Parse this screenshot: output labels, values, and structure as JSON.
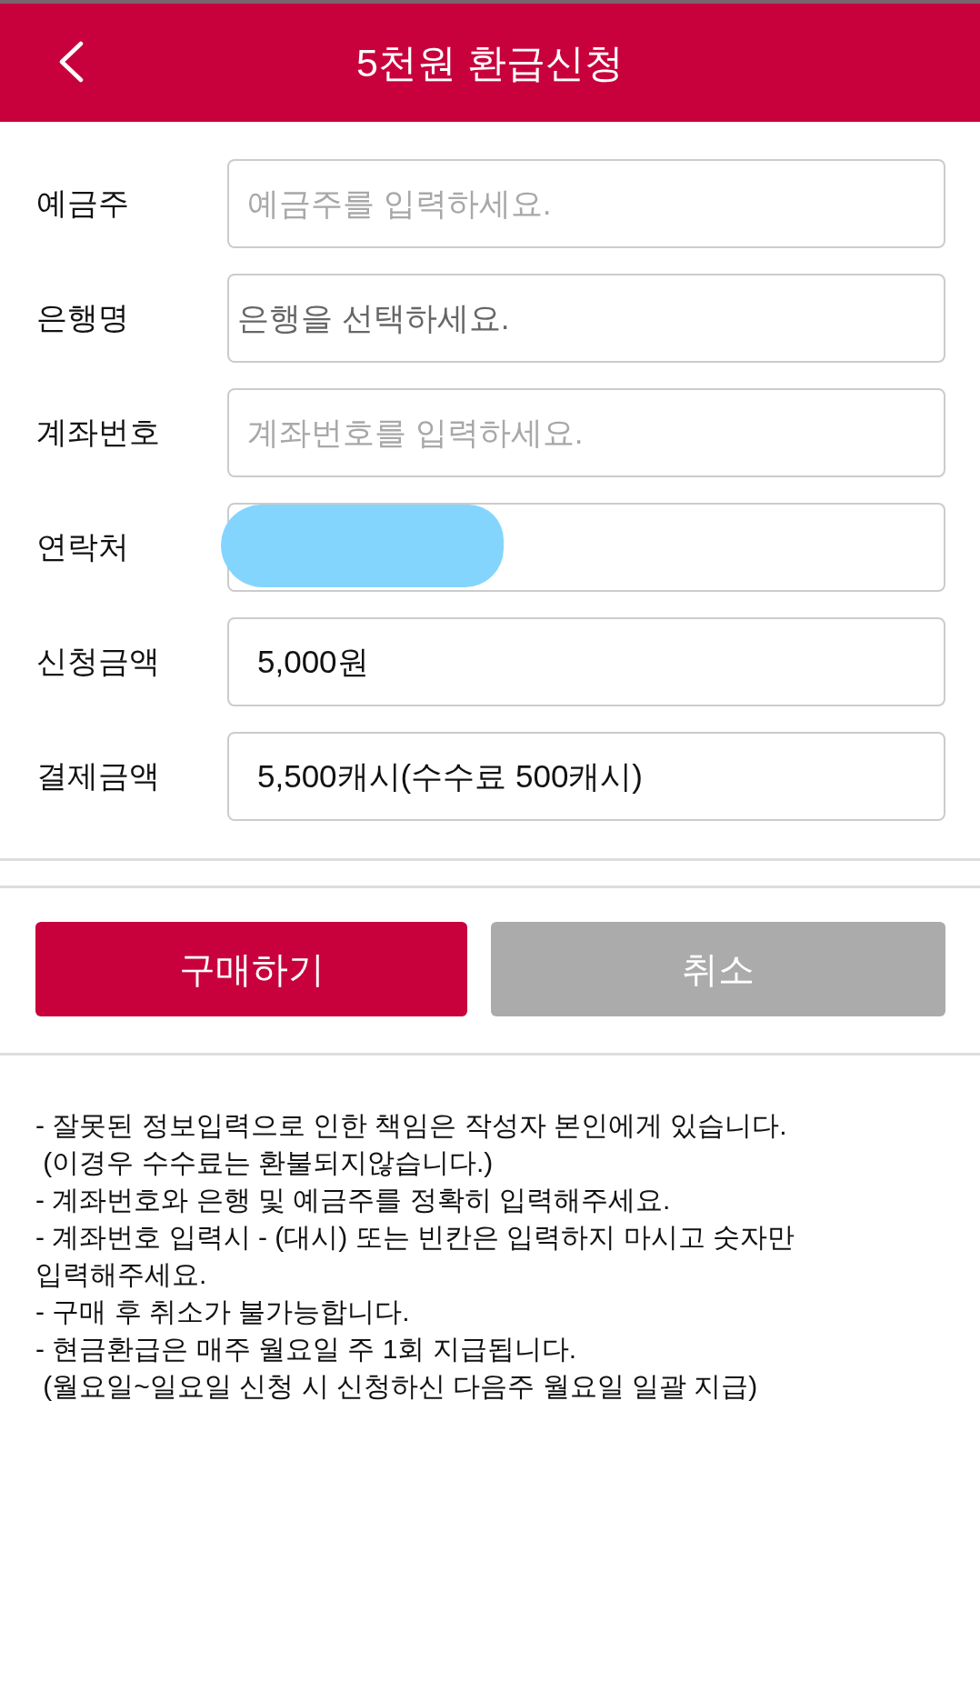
{
  "header": {
    "title": "5천원 환급신청"
  },
  "form": {
    "fields": [
      {
        "label": "예금주",
        "kind": "input",
        "placeholder": "예금주를 입력하세요."
      },
      {
        "label": "은행명",
        "kind": "select",
        "value": "은행을 선택하세요."
      },
      {
        "label": "계좌번호",
        "kind": "input",
        "placeholder": "계좌번호를 입력하세요."
      },
      {
        "label": "연락처",
        "kind": "input",
        "redacted": true
      },
      {
        "label": "신청금액",
        "kind": "input",
        "value": "5,000원"
      },
      {
        "label": "결제금액",
        "kind": "input",
        "value": "5,500캐시(수수료 500캐시)"
      }
    ]
  },
  "buttons": [
    {
      "label": "구매하기",
      "kind": "primary"
    },
    {
      "label": "취소",
      "kind": "secondary"
    }
  ],
  "notes": [
    "- 잘못된 정보입력으로 인한 책임은 작성자 본인에게 있습니다.",
    " (이경우 수수료는 환불되지않습니다.)",
    "- 계좌번호와 은행 및 예금주를 정확히 입력해주세요.",
    "- 계좌번호 입력시 - (대시) 또는 빈칸은 입력하지 마시고 숫자만 입력해주세요.",
    "- 구매 후 취소가 불가능합니다.",
    "- 현금환급은 매주 월요일 주 1회 지급됩니다.",
    " (월요일~일요일 신청 시 신청하신 다음주 월요일 일괄 지급)"
  ]
}
